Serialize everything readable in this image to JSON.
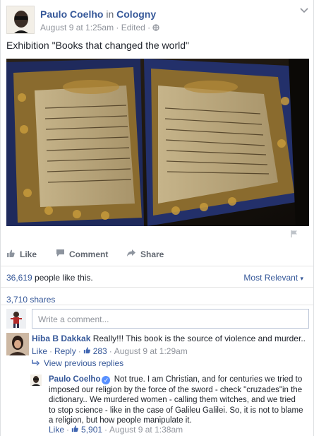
{
  "post": {
    "author": "Paulo Coelho",
    "location_prefix": "in",
    "location": "Cologny",
    "date": "August 9 at 1:25am",
    "edited": "Edited",
    "meta_sep": "·",
    "text": "Exhibition \"Books that changed the world\""
  },
  "actions": {
    "like": "Like",
    "comment": "Comment",
    "share": "Share"
  },
  "stats": {
    "likes_count": "36,619",
    "likes_suffix": "people like this.",
    "sort_label": "Most Relevant",
    "sort_caret": "▾",
    "shares": "3,710 shares"
  },
  "composer": {
    "placeholder": "Write a comment..."
  },
  "comment": {
    "author": "Hiba B Dakkak",
    "text": "Really!!! This book is the source of violence and murder..",
    "like": "Like",
    "reply": "Reply",
    "sep": "·",
    "reactions": "283",
    "time": "August 9 at 1:29am",
    "view_previous": "View previous replies"
  },
  "reply": {
    "author": "Paulo Coelho",
    "text": "Not true. I am Christian, and for centuries we tried to imposed our religion by the force of the sword - check \"cruzades\"in the dictionary.. We murdered women - calling them witches, and we tried to stop science - like in the case of Galileu Galilei. So, it is not to blame a religion, but how people manipulate it.",
    "like": "Like",
    "sep": "·",
    "reactions": "5,901",
    "time": "August 9 at 1:38am"
  },
  "colors": {
    "link": "#365899",
    "action_grey": "#616770",
    "meta_grey": "#90949c",
    "verified": "#5890ff",
    "like_blue": "#4267b2"
  },
  "icons": {
    "chevron": "chevron-down-icon",
    "globe": "globe-icon",
    "flag": "flag-icon",
    "like": "thumbs-up-icon",
    "comment": "comment-bubble-icon",
    "share": "share-arrow-icon",
    "reply_arrow": "reply-arrow-icon",
    "verified": "verified-badge-icon"
  }
}
